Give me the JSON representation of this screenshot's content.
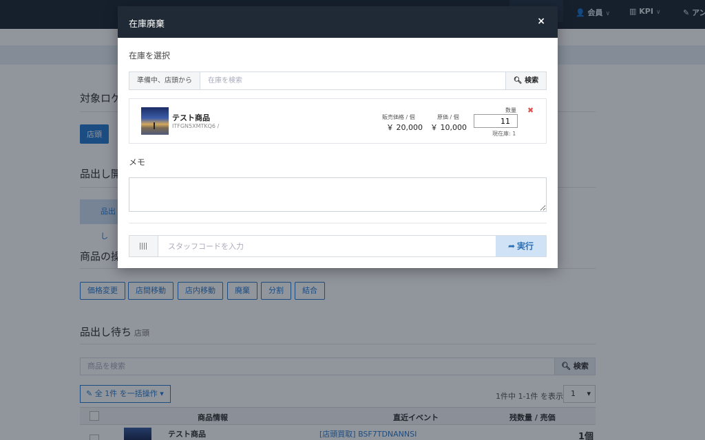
{
  "nav": {
    "items": [
      {
        "label": "会員",
        "icon": "user-icon"
      },
      {
        "label": "KPI",
        "icon": "bar-chart-icon"
      },
      {
        "label": "アン",
        "icon": "edit-icon"
      }
    ]
  },
  "background": {
    "section_target": "対象ロケ",
    "target_button": "店頭",
    "section_start": "品出し開",
    "start_tab": "品出し",
    "section_ops": "商品の操",
    "ops_buttons": [
      "価格変更",
      "店間移動",
      "店内移動",
      "廃棄",
      "分割",
      "結合"
    ],
    "waiting_title": "品出し待ち",
    "waiting_sub": "店頭",
    "search_placeholder": "商品を検索",
    "search_button": "検索",
    "bulk_button": "全 1件 を一括操作",
    "pagination_text": "1件中 1-1件 を表示",
    "page_select": "1",
    "table_headers": [
      "商品情報",
      "直近イベント",
      "残数量 / 売価"
    ],
    "row": {
      "name": "テスト商品",
      "event": "[店頭買取] BSF7TDNANNSI",
      "qty": "1個"
    }
  },
  "modal": {
    "title": "在庫廃棄",
    "close_label": "×",
    "select_label": "在庫を選択",
    "search_prefix": "準備中、店頭から",
    "search_placeholder": "在庫を検索",
    "search_button": "検索",
    "item": {
      "name": "テスト商品",
      "code": "ITFGN5XMTKQ6 /",
      "sale_price_label": "販売価格 / 個",
      "sale_price": "￥ 20,000",
      "cost_label": "原価 / 個",
      "cost": "￥ 10,000",
      "qty_label": "数量",
      "qty_value": "11",
      "stock_text": "現在庫: 1"
    },
    "memo_label": "メモ",
    "memo_value": "",
    "staff_placeholder": "スタッフコードを入力",
    "exec_button": "実行"
  }
}
